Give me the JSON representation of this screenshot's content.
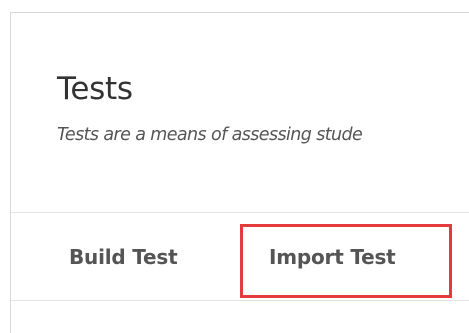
{
  "header": {
    "title": "Tests",
    "subtitle": "Tests are a means of assessing stude"
  },
  "tabs": [
    {
      "label": "Build Test"
    },
    {
      "label": "Import Test",
      "highlighted": true
    }
  ],
  "colors": {
    "highlight_border": "#e53b3b",
    "text_dark": "#333333",
    "text_muted": "#555555"
  }
}
